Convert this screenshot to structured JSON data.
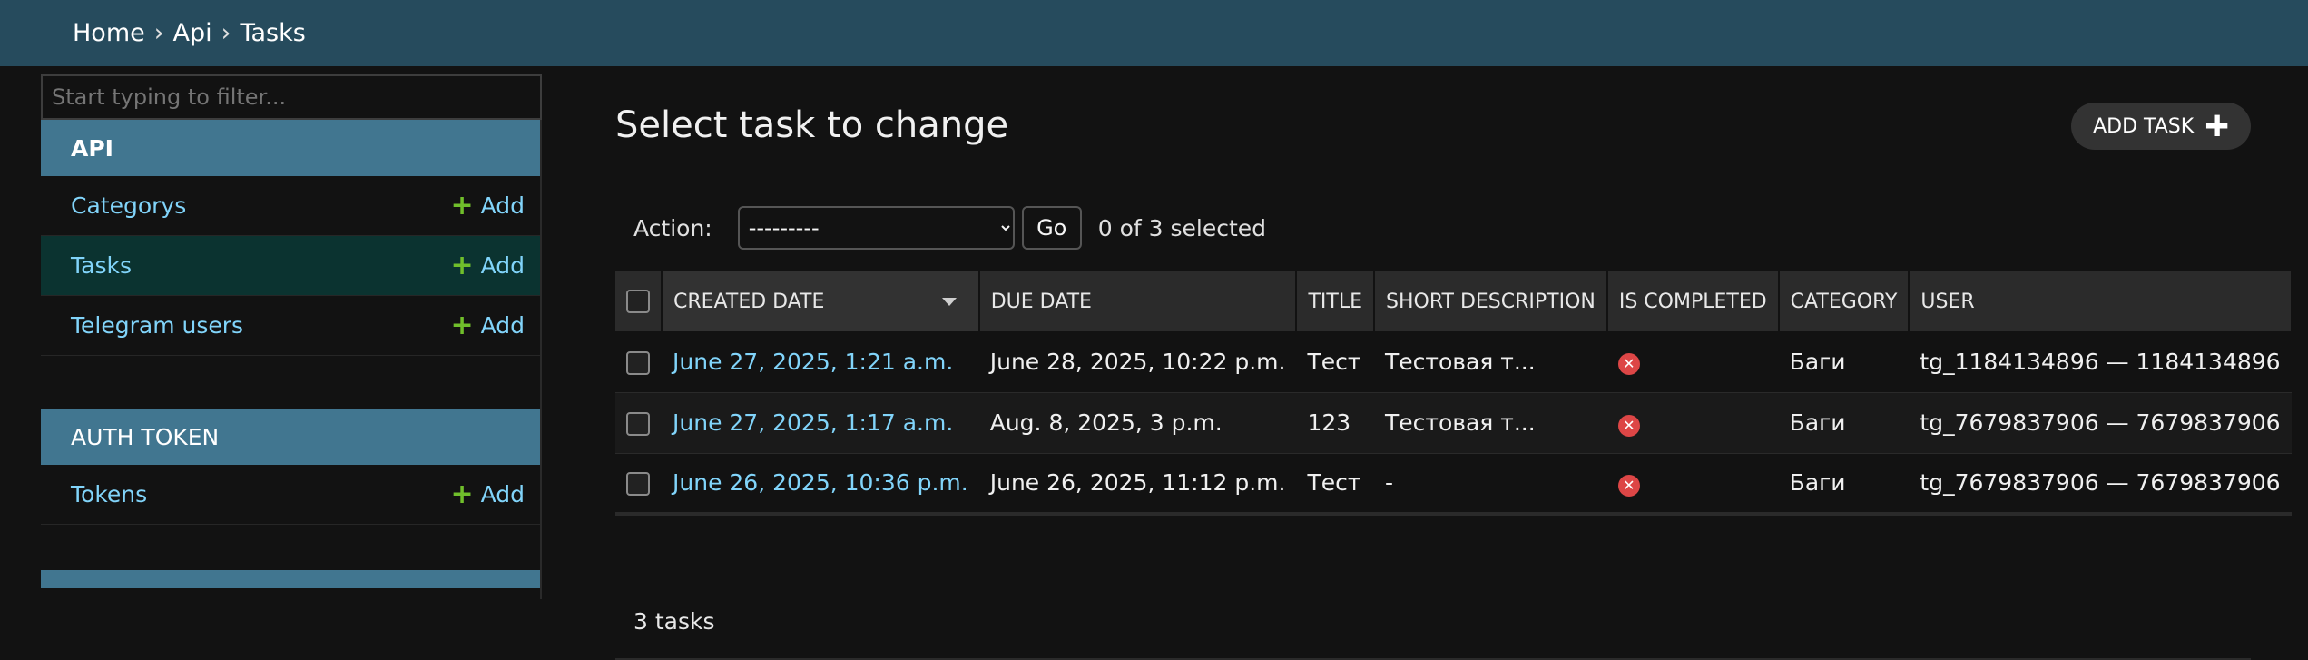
{
  "breadcrumb": {
    "home": "Home",
    "sep": "›",
    "app": "Api",
    "current": "Tasks"
  },
  "sidebar": {
    "filter_placeholder": "Start typing to filter...",
    "modules": [
      {
        "title": "API",
        "items": [
          {
            "label": "Categorys",
            "add": "Add"
          },
          {
            "label": "Tasks",
            "add": "Add"
          },
          {
            "label": "Telegram users",
            "add": "Add"
          }
        ]
      },
      {
        "title": "AUTH TOKEN",
        "items": [
          {
            "label": "Tokens",
            "add": "Add"
          }
        ]
      }
    ]
  },
  "main": {
    "title": "Select task to change",
    "add_button": "ADD TASK",
    "action_label": "Action:",
    "action_selected": "---------",
    "go_label": "Go",
    "selected_counter": "0 of 3 selected",
    "columns": [
      "CREATED DATE",
      "DUE DATE",
      "TITLE",
      "SHORT DESCRIPTION",
      "IS COMPLETED",
      "CATEGORY",
      "USER"
    ],
    "rows": [
      {
        "created": "June 27, 2025, 1:21 a.m.",
        "due": "June 28, 2025, 10:22 p.m.",
        "title": "Тест",
        "short": "Тестовая т...",
        "completed": false,
        "category": "Баги",
        "user": "tg_1184134896 — 1184134896"
      },
      {
        "created": "June 27, 2025, 1:17 a.m.",
        "due": "Aug. 8, 2025, 3 p.m.",
        "title": "123",
        "short": "Тестовая т...",
        "completed": false,
        "category": "Баги",
        "user": "tg_7679837906 — 7679837906"
      },
      {
        "created": "June 26, 2025, 10:36 p.m.",
        "due": "June 26, 2025, 11:12 p.m.",
        "title": "Тест",
        "short": "-",
        "completed": false,
        "category": "Баги",
        "user": "tg_7679837906 — 7679837906"
      }
    ],
    "paginator": "3 tasks"
  },
  "colors": {
    "header": "#264b5d",
    "module": "#417690",
    "link": "#81d4fa",
    "add_plus": "#70bf2b",
    "no_icon": "#dd4646"
  }
}
